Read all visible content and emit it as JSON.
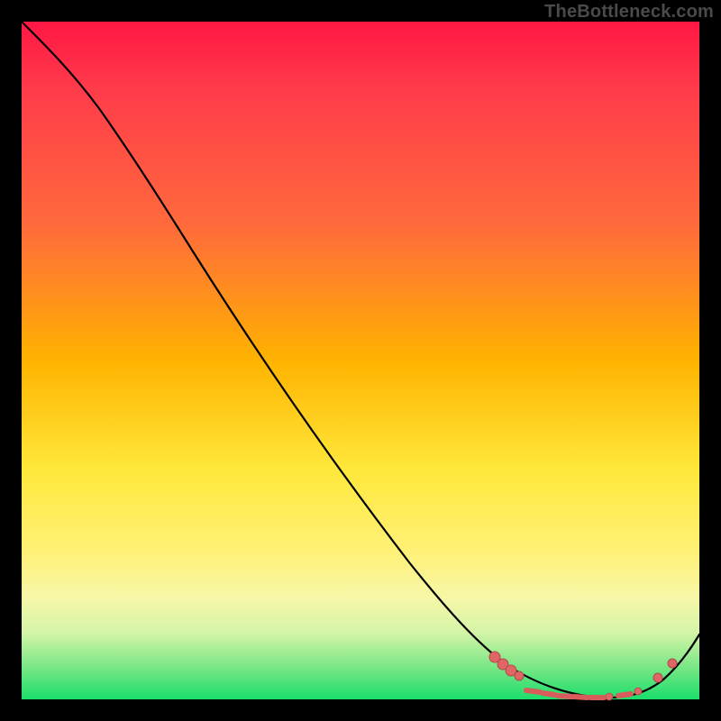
{
  "watermark": "TheBottleneck.com",
  "chart_data": {
    "type": "line",
    "title": "",
    "xlabel": "",
    "ylabel": "",
    "xlim": [
      0,
      100
    ],
    "ylim": [
      0,
      100
    ],
    "grid": false,
    "legend": false,
    "background_gradient": {
      "direction": "vertical",
      "stops": [
        {
          "pos": 0,
          "color": "#ff1744"
        },
        {
          "pos": 30,
          "color": "#ff6a3c"
        },
        {
          "pos": 50,
          "color": "#ffb300"
        },
        {
          "pos": 70,
          "color": "#ffe83a"
        },
        {
          "pos": 88,
          "color": "#f7f7a8"
        },
        {
          "pos": 100,
          "color": "#1bde6b"
        }
      ]
    },
    "series": [
      {
        "name": "curve",
        "x": [
          0,
          4,
          8,
          12,
          16,
          20,
          30,
          40,
          50,
          60,
          68,
          72,
          76,
          80,
          84,
          88,
          92,
          96,
          100
        ],
        "y": [
          100,
          98,
          95,
          92,
          88,
          84,
          72,
          59,
          46,
          33,
          22,
          16,
          10,
          5,
          2,
          0,
          1,
          5,
          11
        ],
        "stroke": "#000000"
      }
    ],
    "marker_clusters": [
      {
        "name": "valley-dense",
        "approx_x_range": [
          70,
          90
        ],
        "approx_y_range": [
          0,
          12
        ],
        "count": 16,
        "color": "#e06666"
      },
      {
        "name": "right-sparse",
        "points": [
          {
            "x": 93,
            "y": 3
          },
          {
            "x": 96,
            "y": 6
          }
        ],
        "color": "#e06666"
      }
    ]
  }
}
